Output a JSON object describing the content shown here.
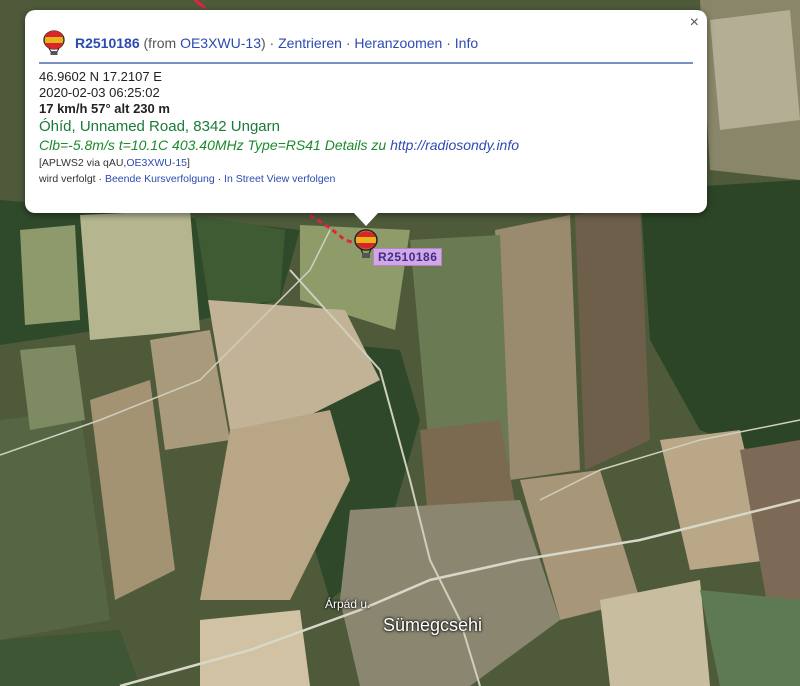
{
  "popup": {
    "close_symbol": "×",
    "callsign": "R2510186",
    "from_prefix": "(from ",
    "from_station": "OE3XWU-13",
    "from_suffix": ")",
    "sep": " · ",
    "center_label": "Zentrieren",
    "zoom_label": "Heranzoomen",
    "info_label": "Info",
    "coords": "46.9602 N 17.2107 E",
    "timestamp": "2020-02-03 06:25:02",
    "speed_line": "17 km/h 57° alt 230 m",
    "location": "Óhíd, Unnamed Road, 8342 Ungarn",
    "comment_text": "Clb=-5.8m/s t=10.1C 403.40MHz Type=RS41 Details zu ",
    "comment_url": "http://radiosondy.info",
    "path_prefix": "[APLWS2 via qAU,",
    "path_link": "OE3XWU-15",
    "path_suffix": "]",
    "tracking_status": "wird verfolgt",
    "stop_tracking_label": "Beende Kursverfolgung",
    "street_view_label": "In Street View verfolgen"
  },
  "marker": {
    "label": "R2510186"
  },
  "map": {
    "street_label": "Árpád u.",
    "town_label": "Sümegcsehi"
  },
  "colors": {
    "link": "#2c4bb0",
    "location": "#1a7a3a",
    "comment": "#1a8a2a",
    "marker_label_bg": "#d3a6e6"
  },
  "icons": {
    "balloon": "balloon-icon",
    "close": "close-icon"
  }
}
